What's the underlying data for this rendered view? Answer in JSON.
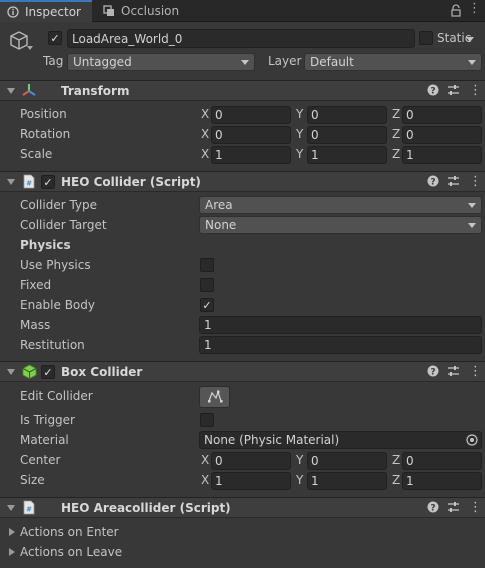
{
  "tabs": [
    {
      "label": "Inspector",
      "icon": "info-icon"
    },
    {
      "label": "Occlusion",
      "icon": "occlusion-icon"
    }
  ],
  "object": {
    "name": "LoadArea_World_0",
    "active": true,
    "static_label": "Static",
    "tag_label": "Tag",
    "tag_value": "Untagged",
    "layer_label": "Layer",
    "layer_value": "Default"
  },
  "transform": {
    "title": "Transform",
    "rows": [
      {
        "label": "Position",
        "x": "0",
        "y": "0",
        "z": "0"
      },
      {
        "label": "Rotation",
        "x": "0",
        "y": "0",
        "z": "0"
      },
      {
        "label": "Scale",
        "x": "1",
        "y": "1",
        "z": "1"
      }
    ],
    "axis": [
      "X",
      "Y",
      "Z"
    ]
  },
  "heo_collider": {
    "title": "HEO Collider (Script)",
    "enabled": true,
    "collider_type_label": "Collider Type",
    "collider_type_value": "Area",
    "collider_target_label": "Collider Target",
    "collider_target_value": "None",
    "physics_header": "Physics",
    "use_physics_label": "Use Physics",
    "use_physics": false,
    "fixed_label": "Fixed",
    "fixed": false,
    "enable_body_label": "Enable Body",
    "enable_body": true,
    "mass_label": "Mass",
    "mass_value": "1",
    "restitution_label": "Restitution",
    "restitution_value": "1"
  },
  "box_collider": {
    "title": "Box Collider",
    "enabled": true,
    "edit_collider_label": "Edit Collider",
    "is_trigger_label": "Is Trigger",
    "is_trigger": false,
    "material_label": "Material",
    "material_value": "None (Physic Material)",
    "center_label": "Center",
    "center": {
      "x": "0",
      "y": "0",
      "z": "0"
    },
    "size_label": "Size",
    "size": {
      "x": "1",
      "y": "1",
      "z": "1"
    }
  },
  "heo_areacollider": {
    "title": "HEO Areacollider (Script)",
    "actions_enter_label": "Actions on Enter",
    "actions_leave_label": "Actions on Leave"
  },
  "colors": {
    "accent": "#3a79bb",
    "background": "#383838",
    "header": "#3e3e3e"
  }
}
